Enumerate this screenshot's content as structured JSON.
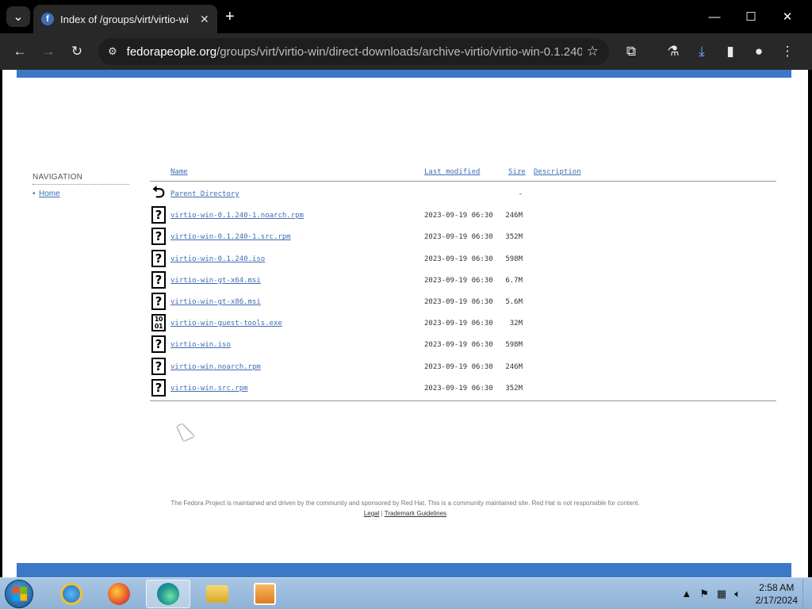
{
  "browser": {
    "tab_title": "Index of /groups/virt/virtio-wi",
    "url_host": "fedorapeople.org",
    "url_path": "/groups/virt/virtio-win/direct-downloads/archive-virtio/virtio-win-0.1.240..."
  },
  "navigation": {
    "heading": "NAVIGATION",
    "items": [
      {
        "label": "Home"
      }
    ]
  },
  "listing": {
    "headers": {
      "name": "Name",
      "modified": "Last modified",
      "size": "Size",
      "description": "Description"
    },
    "parent": {
      "name": "Parent Directory",
      "size": "-"
    },
    "files": [
      {
        "name": "virtio-win-0.1.240-1.noarch.rpm",
        "modified": "2023-09-19 06:30",
        "size": "246M",
        "icon": "unknown-file-icon"
      },
      {
        "name": "virtio-win-0.1.240-1.src.rpm",
        "modified": "2023-09-19 06:30",
        "size": "352M",
        "icon": "unknown-file-icon"
      },
      {
        "name": "virtio-win-0.1.240.iso",
        "modified": "2023-09-19 06:30",
        "size": "598M",
        "icon": "unknown-file-icon"
      },
      {
        "name": "virtio-win-gt-x64.msi",
        "modified": "2023-09-19 06:30",
        "size": "6.7M",
        "icon": "unknown-file-icon"
      },
      {
        "name": "virtio-win-gt-x86.msi",
        "modified": "2023-09-19 06:30",
        "size": "5.6M",
        "icon": "unknown-file-icon"
      },
      {
        "name": "virtio-win-guest-tools.exe",
        "modified": "2023-09-19 06:30",
        "size": "32M",
        "icon": "binary-file-icon"
      },
      {
        "name": "virtio-win.iso",
        "modified": "2023-09-19 06:30",
        "size": "598M",
        "icon": "unknown-file-icon"
      },
      {
        "name": "virtio-win.noarch.rpm",
        "modified": "2023-09-19 06:30",
        "size": "246M",
        "icon": "unknown-file-icon"
      },
      {
        "name": "virtio-win.src.rpm",
        "modified": "2023-09-19 06:30",
        "size": "352M",
        "icon": "unknown-file-icon"
      }
    ]
  },
  "footer": {
    "text": "The Fedora Project is maintained and driven by the community and sponsored by Red Hat. This is a community maintained site. Red Hat is not responsible for content.",
    "legal": "Legal",
    "separator": "|",
    "trademark": "Trademark Guidelines"
  },
  "taskbar": {
    "time": "2:58 AM",
    "date": "2/17/2024"
  },
  "colors": {
    "accent_band": "#3c78c6",
    "link": "#3c6eb4"
  }
}
